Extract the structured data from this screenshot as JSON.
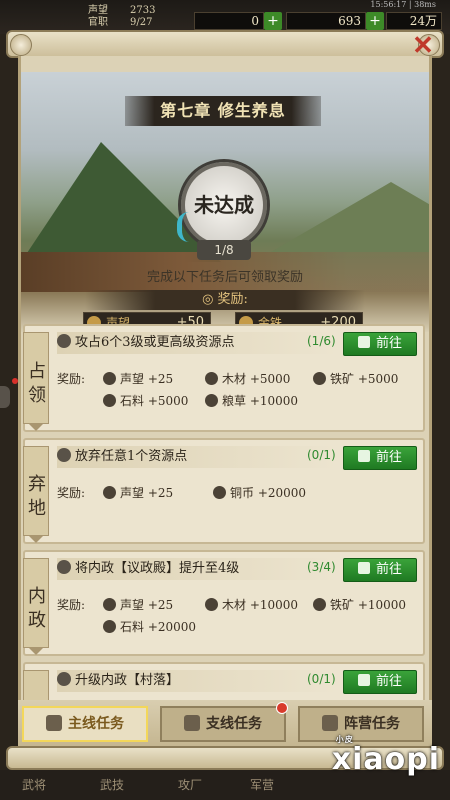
{
  "status_bar": {
    "rank_labels": [
      "声望",
      "官职"
    ],
    "rank_values": [
      "2733",
      "9/27"
    ],
    "resource_1": "0",
    "resource_2": "693",
    "resource_3": "24万",
    "system": "15:56:17 | 38ms"
  },
  "chapter_title": "第七章 修生养息",
  "status": {
    "label": "未达成",
    "progress": "1/8",
    "progress_fraction": 0.125
  },
  "instruction": "完成以下任务后可领取奖励",
  "rewards_header": "奖励:",
  "chapter_rewards": [
    {
      "label": "声望",
      "value": "+50",
      "icon": "prestige-icon"
    },
    {
      "label": "金铢",
      "value": "+200",
      "icon": "gold-icon"
    }
  ],
  "quests": [
    {
      "tag": "占领",
      "title": "攻占6个3级或更高级资源点",
      "progress": "(1/6)",
      "button": "前往",
      "reward_label": "奖励:",
      "rewards": [
        "声望 +25",
        "木材 +5000",
        "铁矿 +5000",
        "石料 +5000",
        "粮草 +10000"
      ]
    },
    {
      "tag": "弃地",
      "title": "放弃任意1个资源点",
      "progress": "(0/1)",
      "button": "前往",
      "reward_label": "奖励:",
      "rewards": [
        "声望 +25",
        "铜币 +20000"
      ]
    },
    {
      "tag": "内政",
      "title": "将内政【议政殿】提升至4级",
      "progress": "(3/4)",
      "button": "前往",
      "reward_label": "奖励:",
      "rewards": [
        "声望 +25",
        "木材 +10000",
        "铁矿 +10000",
        "石料 +20000"
      ]
    },
    {
      "tag": "内",
      "title": "升级内政【村落】",
      "progress": "(0/1)",
      "button": "前往"
    }
  ],
  "tabs": [
    {
      "label": "主线任务",
      "active": true
    },
    {
      "label": "支线任务",
      "badge": true
    },
    {
      "label": "阵营任务"
    }
  ],
  "bottom_nav": [
    "武将",
    "武技",
    "攻厂",
    "军营"
  ],
  "watermark": {
    "main": "xiaopi",
    "small": "小皮"
  }
}
